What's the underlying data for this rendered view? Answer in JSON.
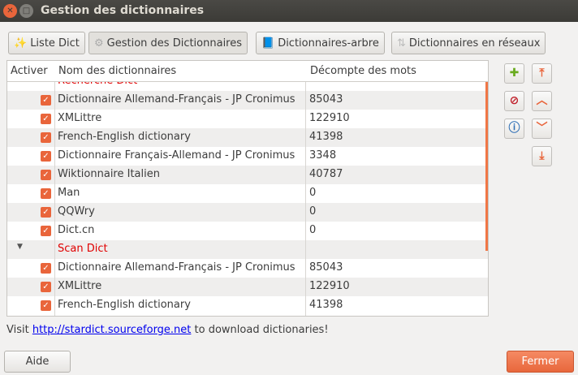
{
  "window": {
    "title": "Gestion des dictionnaires"
  },
  "tabs": [
    {
      "label": "Liste Dict",
      "icon": "wand-icon"
    },
    {
      "label": "Gestion des Dictionnaires",
      "icon": "gear-icon"
    },
    {
      "label": "Dictionnaires-arbre",
      "icon": "book-icon"
    },
    {
      "label": "Dictionnaires en réseaux",
      "icon": "network-icon"
    }
  ],
  "table": {
    "headers": [
      "Activer",
      "Nom des dictionnaires",
      "Décompte des mots"
    ],
    "groups": [
      {
        "name": "Recherche Dict",
        "rows": [
          {
            "name": "Dictionnaire Allemand-Français - JP Cronimus",
            "count": "85043"
          },
          {
            "name": "XMLittre",
            "count": "122910"
          },
          {
            "name": "French-English dictionary",
            "count": "41398"
          },
          {
            "name": "Dictionnaire Français-Allemand - JP Cronimus",
            "count": "3348"
          },
          {
            "name": "Wiktionnaire Italien",
            "count": "40787"
          },
          {
            "name": "Man",
            "count": "0"
          },
          {
            "name": "QQWry",
            "count": "0"
          },
          {
            "name": "Dict.cn",
            "count": "0"
          }
        ]
      },
      {
        "name": "Scan Dict",
        "rows": [
          {
            "name": "Dictionnaire Allemand-Français - JP Cronimus",
            "count": "85043"
          },
          {
            "name": "XMLittre",
            "count": "122910"
          },
          {
            "name": "French-English dictionary",
            "count": "41398"
          }
        ]
      }
    ]
  },
  "footer": {
    "prefix": "Visit ",
    "link": "http://stardict.sourceforge.net",
    "suffix": " to download dictionaries!"
  },
  "buttons": {
    "help": "Aide",
    "close": "Fermer"
  },
  "colors": {
    "accent": "#e9653b",
    "group": "#e00000"
  }
}
